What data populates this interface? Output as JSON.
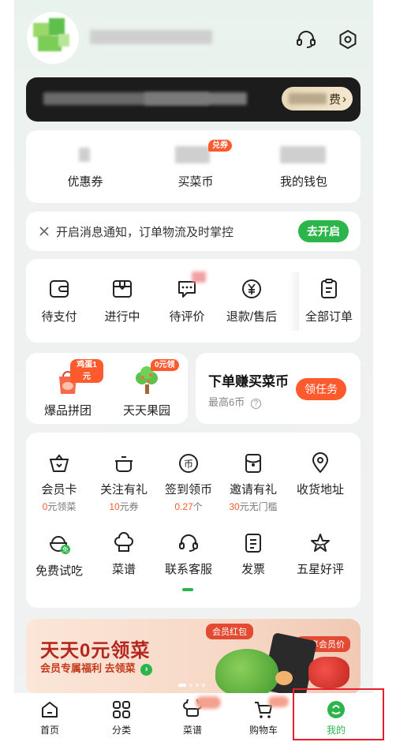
{
  "stats": [
    {
      "label": "优惠券"
    },
    {
      "label": "买菜币",
      "badge": "兑券"
    },
    {
      "label": "我的钱包"
    }
  ],
  "banner": {
    "pill_text": "费"
  },
  "notify": {
    "text": "开启消息通知，订单物流及时掌控",
    "button": "去开启"
  },
  "orders": [
    {
      "label": "待支付",
      "icon": "wallet-icon"
    },
    {
      "label": "进行中",
      "icon": "box-icon"
    },
    {
      "label": "待评价",
      "icon": "comment-icon"
    },
    {
      "label": "退款/售后",
      "icon": "yen-icon"
    },
    {
      "label": "全部订单",
      "icon": "clipboard-icon"
    }
  ],
  "promos": {
    "left": [
      {
        "label": "爆品拼团",
        "badge": "鸡蛋1元"
      },
      {
        "label": "天天果园",
        "badge": "0元领"
      }
    ],
    "right": {
      "title": "下单赚买菜币",
      "sub": "最高6币",
      "button": "领任务"
    }
  },
  "services": [
    {
      "label": "会员卡",
      "sub_hl": "0",
      "sub": "元领菜",
      "icon": "basket-icon"
    },
    {
      "label": "关注有礼",
      "sub_hl": "10",
      "sub": "元券",
      "icon": "pot-icon"
    },
    {
      "label": "签到领币",
      "sub_hl": "0.27",
      "sub": "个",
      "icon": "coin-icon"
    },
    {
      "label": "邀请有礼",
      "sub_hl": "30",
      "sub": "元无门槛",
      "icon": "envelope-icon"
    },
    {
      "label": "收货地址",
      "sub_hl": "",
      "sub": "",
      "icon": "location-icon"
    },
    {
      "label": "免费试吃",
      "icon": "bowl-icon"
    },
    {
      "label": "菜谱",
      "icon": "chef-hat-icon"
    },
    {
      "label": "联系客服",
      "icon": "headset-icon"
    },
    {
      "label": "发票",
      "icon": "invoice-icon"
    },
    {
      "label": "五星好评",
      "icon": "star-icon"
    }
  ],
  "ad": {
    "title": "天天0元领菜",
    "sub": "会员专属福利 去领菜",
    "tag1": "会员红包",
    "tag2": "专享会员价"
  },
  "tabs": [
    {
      "label": "首页",
      "icon": "home-icon"
    },
    {
      "label": "分类",
      "icon": "category-icon"
    },
    {
      "label": "菜谱",
      "icon": "recipe-icon"
    },
    {
      "label": "购物车",
      "icon": "cart-icon"
    },
    {
      "label": "我的",
      "icon": "profile-icon",
      "active": true
    }
  ],
  "colors": {
    "accent": "#2cb54a",
    "orange": "#ff5a2e",
    "highlight": "#e5202a"
  }
}
